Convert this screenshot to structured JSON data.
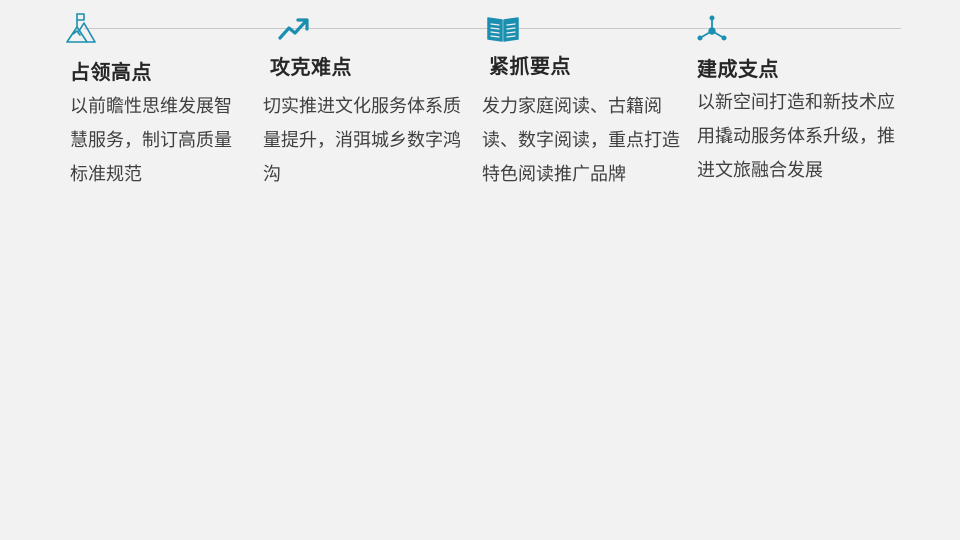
{
  "colors": {
    "background": "#f2f2f2",
    "accent": "#1b8fb0",
    "heading": "#262626",
    "body": "#404040",
    "rule": "#c9c9c9"
  },
  "columns": [
    {
      "icon": "mountain-flag-icon",
      "heading": "占领高点",
      "body": "以前瞻性思维发展智慧服务，制订高质量标准规范"
    },
    {
      "icon": "trend-up-arrow-icon",
      "heading": "攻克难点",
      "body": "切实推进文化服务体系质量提升，消弭城乡数字鸿沟"
    },
    {
      "icon": "open-book-icon",
      "heading": "紧抓要点",
      "body": "发力家庭阅读、古籍阅读、数字阅读，重点打造特色阅读推广品牌"
    },
    {
      "icon": "network-node-icon",
      "heading": "建成支点",
      "body": "以新空间打造和新技术应用撬动服务体系升级，推进文旅融合发展"
    }
  ]
}
